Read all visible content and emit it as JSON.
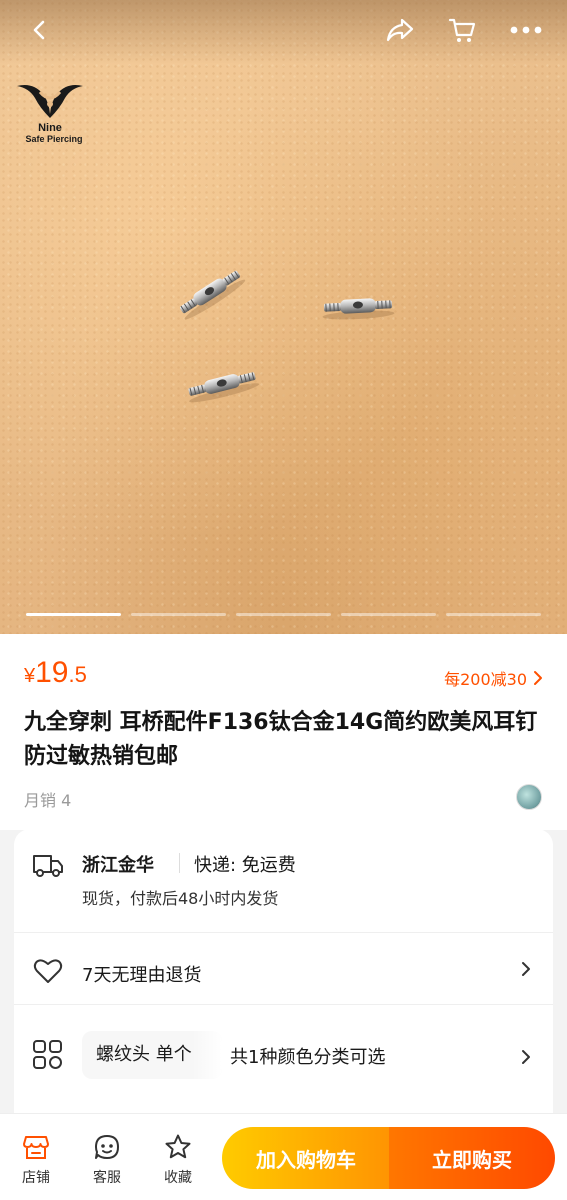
{
  "gallery": {
    "logo": {
      "brand_line1": "Nine",
      "brand_line2": "Safe Piercing"
    },
    "slides_total": 5,
    "slide_active": 1
  },
  "product": {
    "price_symbol": "¥",
    "price_int": "19",
    "price_dec": ".5",
    "promo": "每200减30",
    "title": "九全穿刺 耳桥配件F136钛合金14G简约欧美风耳钉防过敏热销包邮",
    "monthly_sales": "月销 4"
  },
  "shipping": {
    "location": "浙江金华",
    "fee": "快递: 免运费",
    "note": "现货，付款后48小时内发货"
  },
  "returns": {
    "text": "7天无理由退货"
  },
  "spec": {
    "chip": "螺纹头 单个",
    "text": "共1种颜色分类可选"
  },
  "bottom_bar": {
    "store": "店铺",
    "service": "客服",
    "favorite": "收藏",
    "add_to_cart": "加入购物车",
    "buy_now": "立即购买"
  },
  "colors": {
    "accent": "#ff5000",
    "cart_start": "#ffcb00",
    "buy_end": "#ff4900"
  }
}
